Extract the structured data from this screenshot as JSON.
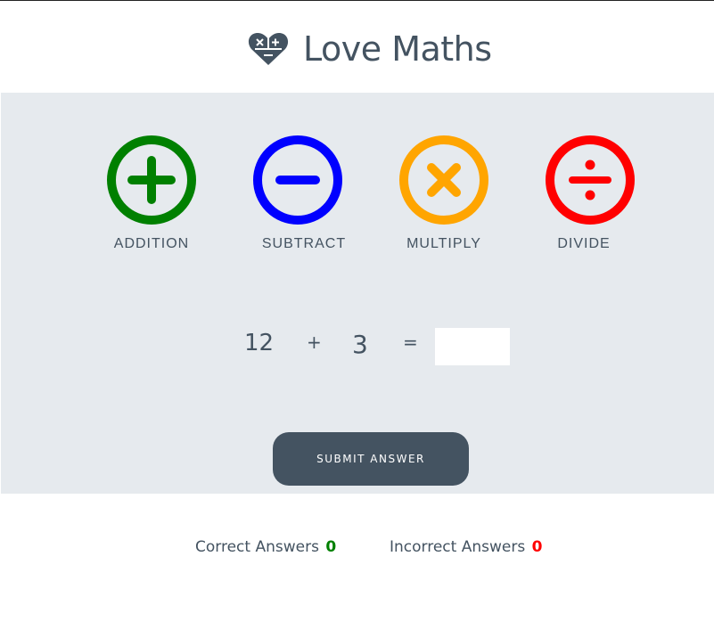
{
  "header": {
    "title": "Love Maths",
    "logo_icon": "heart-calculator-icon"
  },
  "operations": [
    {
      "label": "ADDITION",
      "icon": "plus-circle-icon",
      "color": "#008000"
    },
    {
      "label": "SUBTRACT",
      "icon": "minus-circle-icon",
      "color": "#0000ff"
    },
    {
      "label": "MULTIPLY",
      "icon": "times-circle-icon",
      "color": "#ffa500"
    },
    {
      "label": "DIVIDE",
      "icon": "divide-circle-icon",
      "color": "#ff0000"
    }
  ],
  "question": {
    "operand1": "12",
    "operator": "+",
    "operand2": "3",
    "equals": "=",
    "answer_value": ""
  },
  "submit": {
    "label": "SUBMIT ANSWER"
  },
  "scores": {
    "correct_label": "Correct Answers",
    "correct_value": "0",
    "correct_color": "#008000",
    "incorrect_label": "Incorrect Answers",
    "incorrect_value": "0",
    "incorrect_color": "#ff0000"
  },
  "colors": {
    "text": "#445361",
    "panel_bg": "#e6eaee",
    "button_bg": "#445361"
  }
}
